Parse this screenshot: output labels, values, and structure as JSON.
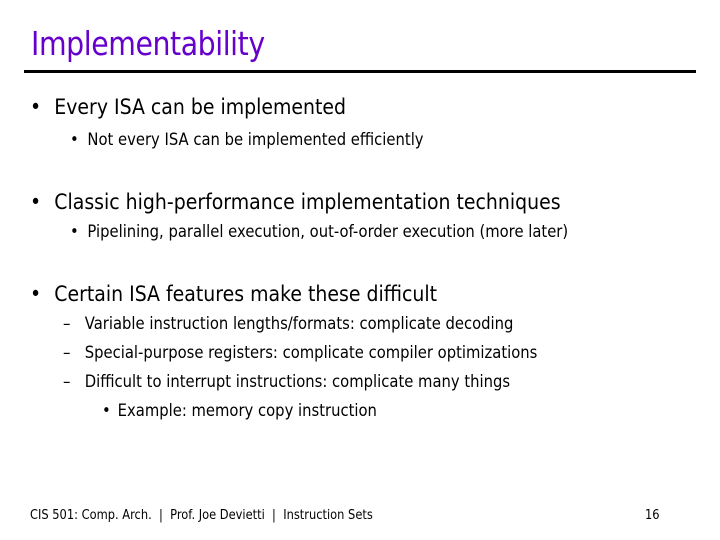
{
  "slide": {
    "title": "Implementability",
    "title_color": "#6600cc",
    "bullets": [
      {
        "marker": "•",
        "text": "Every ISA can be implemented",
        "children": [
          {
            "marker": "•",
            "text": "Not every ISA can be implemented efficiently"
          }
        ]
      },
      {
        "marker": "•",
        "text": "Classic high-performance implementation techniques",
        "children": [
          {
            "marker": "•",
            "text": "Pipelining, parallel execution, out-of-order execution (more later)"
          }
        ]
      },
      {
        "marker": "•",
        "text": "Certain ISA features make these difficult",
        "children": [
          {
            "marker": "–",
            "text": "Variable instruction lengths/formats: complicate decoding"
          },
          {
            "marker": "–",
            "text": "Special-purpose registers: complicate compiler optimizations"
          },
          {
            "marker": "–",
            "text": "Difficult to interrupt instructions: complicate many things",
            "children": [
              {
                "marker": "•",
                "text": "Example: memory copy instruction"
              }
            ]
          }
        ]
      }
    ]
  },
  "footer": {
    "course": "CIS 501: Comp. Arch.",
    "separator": "|",
    "instructor": "Prof. Joe Devietti",
    "topic": "Instruction Sets",
    "page_number": "16"
  }
}
